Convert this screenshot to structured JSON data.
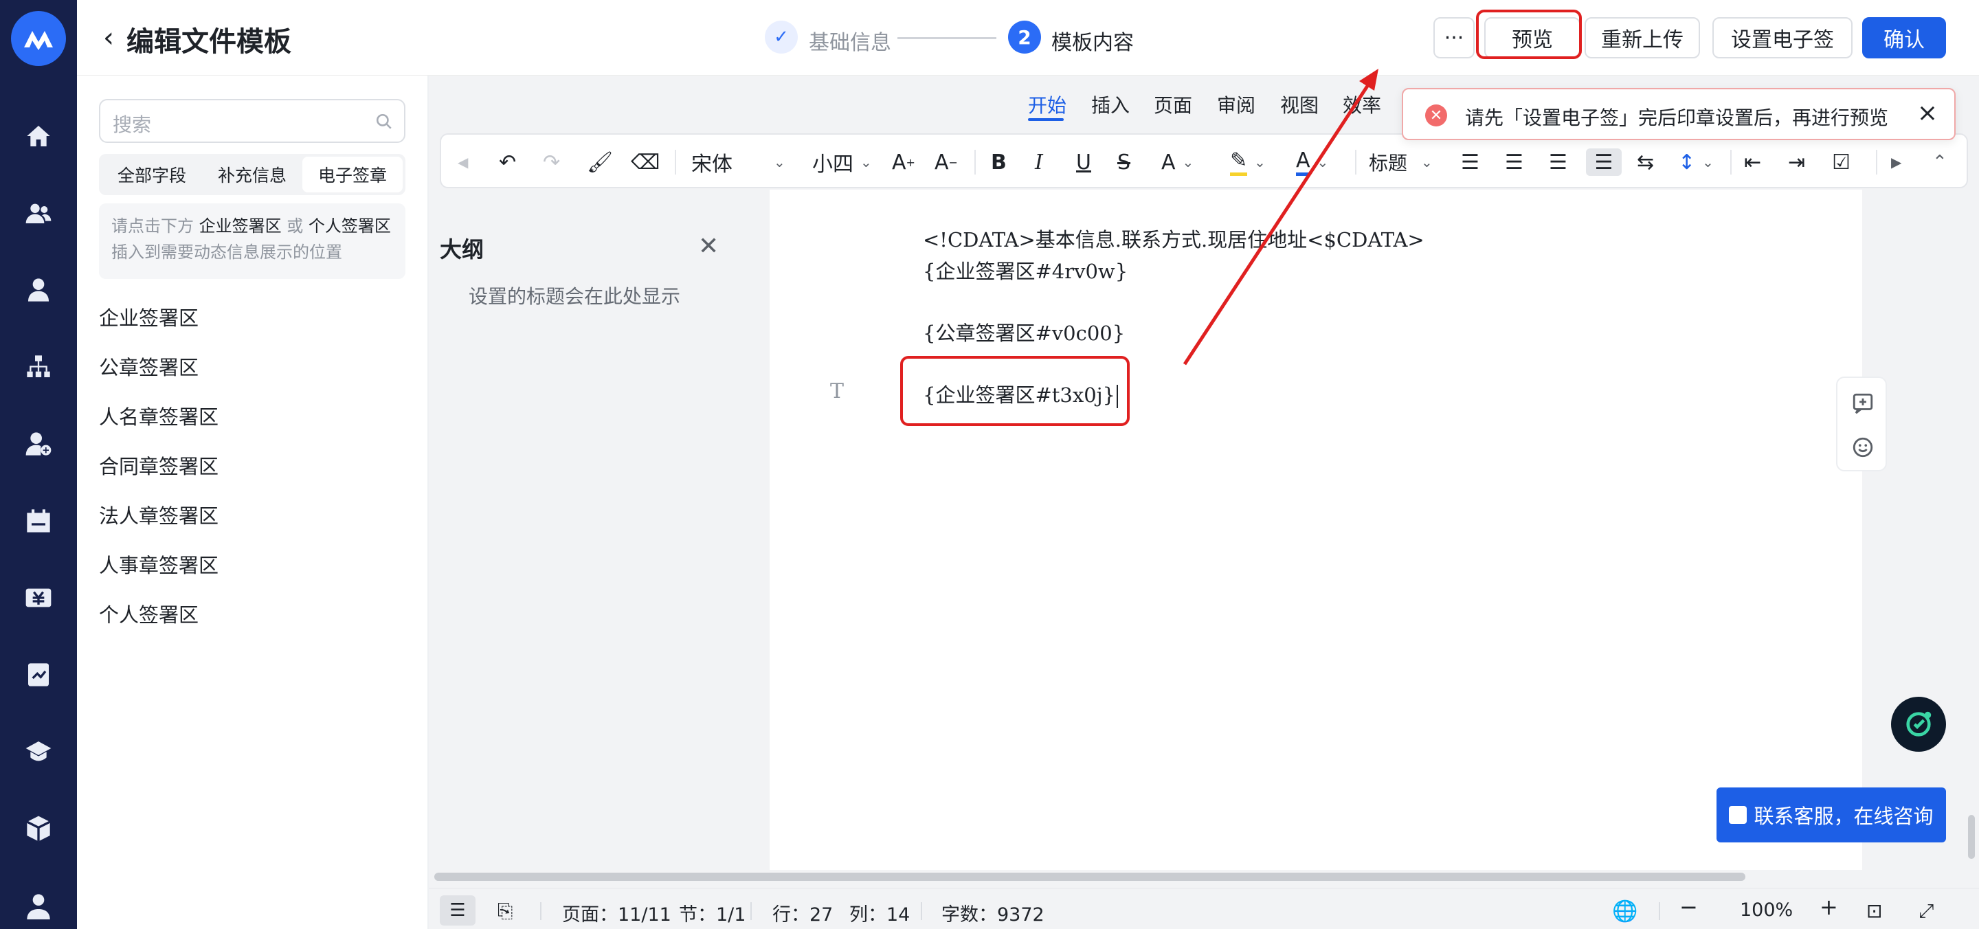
{
  "header": {
    "title": "编辑文件模板",
    "steps": [
      {
        "label": "基础信息",
        "icon": "check-icon"
      },
      {
        "label": "模板内容",
        "number": "2"
      }
    ],
    "more_label": "···",
    "preview_label": "预览",
    "reupload_label": "重新上传",
    "esign_label": "设置电子签",
    "confirm_label": "确认"
  },
  "left_panel": {
    "search_placeholder": "搜索",
    "segments": [
      "全部字段",
      "补充信息",
      "电子签章"
    ],
    "active_segment": "电子签章",
    "hint": {
      "p1": "请点击下方 ",
      "k1": "企业签署区",
      "p2": " 或 ",
      "k2": "个人签署区",
      "p3": "插入到需要动态信息展示的位置"
    },
    "items": [
      "企业签署区",
      "公章签署区",
      "人名章签署区",
      "合同章签署区",
      "法人章签署区",
      "人事章签署区",
      "个人签署区"
    ]
  },
  "editor": {
    "tabs": [
      "开始",
      "插入",
      "页面",
      "审阅",
      "视图",
      "效率"
    ],
    "active_tab": "开始",
    "toolbar": {
      "font": "宋体",
      "size": "小四",
      "heading": "标题"
    },
    "outline": {
      "title": "大纲",
      "hint": "设置的标题会在此处显示"
    },
    "doc_lines": [
      "<!CDATA>基本信息.联系方式.现居住地址<$CDATA>",
      "{企业签署区#4rv0w}",
      "{公章签署区#v0c00}",
      "{企业签署区#t3x0j}"
    ]
  },
  "toast": {
    "message": "请先「设置电子签」完后印章设置后，再进行预览",
    "color": "#f26b6b"
  },
  "support_label": "联系客服，在线咨询",
  "status": {
    "page": "页面：11/11",
    "section": "节：1/1",
    "row": "行：27",
    "col": "列：14",
    "words": "字数：9372",
    "zoom": "100%"
  },
  "colors": {
    "accent": "#1d5fe6",
    "rail": "#16204a",
    "highlight": "#e02020"
  }
}
